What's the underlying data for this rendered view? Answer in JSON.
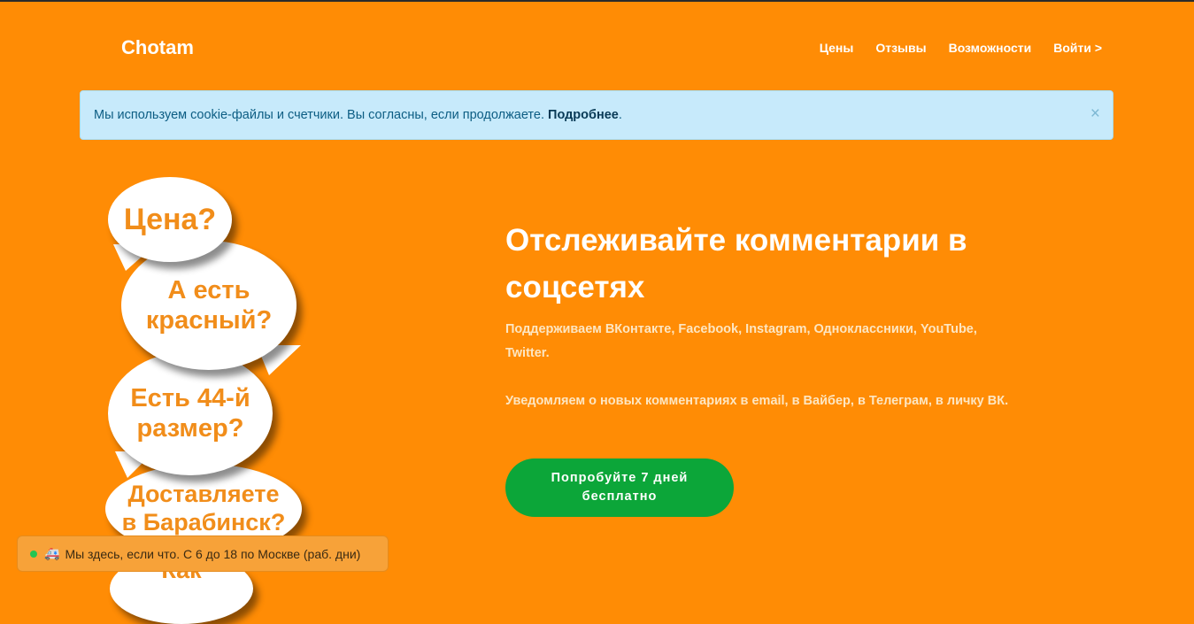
{
  "header": {
    "brand": "Chotam",
    "nav": [
      "Цены",
      "Отзывы",
      "Возможности",
      "Войти  >"
    ]
  },
  "cookie": {
    "text": "Мы используем cookie-файлы и счетчики. Вы согласны, если продолжаете.",
    "link": "Подробнее",
    "period": ".",
    "close": "×"
  },
  "bubbles": [
    "Цена?",
    "А есть красный?",
    "Есть 44-й размер?",
    "Доставляете в Барабинск?",
    "Как"
  ],
  "hero": {
    "title": "Отслеживайте комментарии в соцсетях",
    "p1": "Поддерживаем ВКонтакте, Facebook, Instagram, Одноклассники, YouTube, Twitter.",
    "p2": "Уведомляем о новых комментариях в email, в Вайбер, в Телеграм, в личку ВК.",
    "cta": "Попробуйте 7 дней бесплатно"
  },
  "chat": {
    "status": "online",
    "icon": "truck-icon",
    "text": "Мы здесь, если что. С 6 до 18 по Москве (раб. дни)"
  },
  "colors": {
    "background": "#ff8c05",
    "cta": "#0ca639",
    "alert_bg": "#c7eafb",
    "bubble_text": "#f18d1a"
  }
}
